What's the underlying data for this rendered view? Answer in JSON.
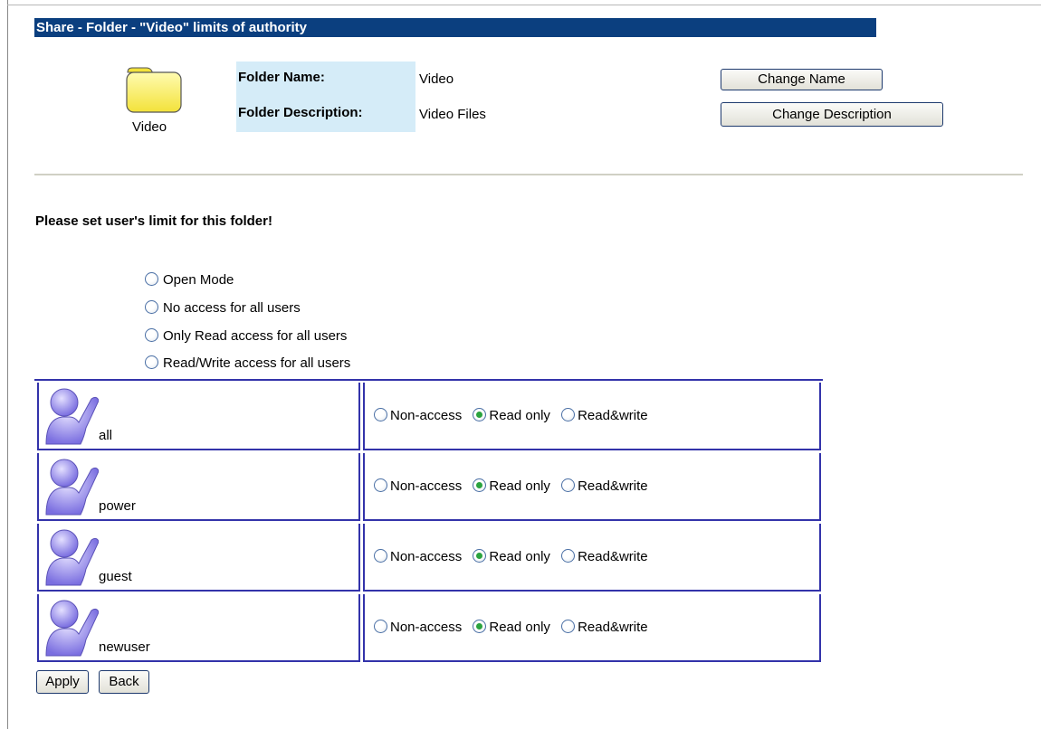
{
  "header": {
    "title": "Share - Folder - \"Video\" limits of authority"
  },
  "folder": {
    "icon_name": "folder-icon",
    "caption": "Video",
    "name_label": "Folder Name:",
    "name_value": "Video",
    "description_label": "Folder Description:",
    "description_value": "Video Files",
    "change_name_button": "Change Name",
    "change_description_button": "Change Description"
  },
  "instruction": "Please set user's limit for this folder!",
  "modes": [
    {
      "label": "Open Mode",
      "selected": false
    },
    {
      "label": "No access for all users",
      "selected": false
    },
    {
      "label": "Only Read access for all users",
      "selected": false
    },
    {
      "label": "Read/Write access for all users",
      "selected": false
    }
  ],
  "permission_options": [
    "Non-access",
    "Read only",
    "Read&write"
  ],
  "users": [
    {
      "name": "all",
      "icon": "user-icon",
      "selected": "Read only"
    },
    {
      "name": "power",
      "icon": "user-icon",
      "selected": "Read only"
    },
    {
      "name": "guest",
      "icon": "user-icon",
      "selected": "Read only"
    },
    {
      "name": "newuser",
      "icon": "user-icon",
      "selected": "Read only"
    }
  ],
  "actions": {
    "apply": "Apply",
    "back": "Back"
  },
  "colors": {
    "title_bar": "#0b3f7f",
    "label_background": "#d5ecf8",
    "table_border": "#3333aa",
    "radio_selected": "#2aa33f"
  }
}
